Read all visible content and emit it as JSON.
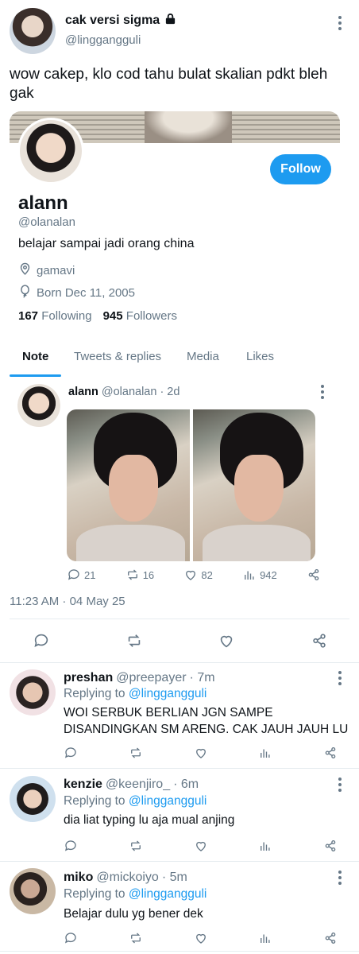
{
  "quote_tweet": {
    "display_name": "cak versi sigma",
    "handle": "@linggangguli",
    "text": "wow cakep, klo cod tahu bulat skalian pdkt bleh gak"
  },
  "profile": {
    "name": "alann",
    "handle": "@olanalan",
    "follow_label": "Follow",
    "bio": "belajar sampai jadi orang china",
    "location": "gamavi",
    "born": "Born Dec 11, 2005",
    "following_count": "167",
    "following_label": "Following",
    "followers_count": "945",
    "followers_label": "Followers",
    "tabs": [
      "Note",
      "Tweets & replies",
      "Media",
      "Likes"
    ],
    "active_tab": "Note"
  },
  "pinned_tweet": {
    "name": "alann",
    "handle": "@olanalan",
    "age": "· 2d",
    "replies": "21",
    "retweets": "16",
    "likes": "82",
    "views": "942",
    "timestamp": "11:23 AM · 04 May 25"
  },
  "replies": [
    {
      "name": "preshan",
      "handle": "@preepayer",
      "age": "· 7m",
      "replying_to_label": "Replying to",
      "replying_to": "@linggangguli",
      "text": "WOI SERBUK BERLIAN JGN SAMPE DISANDINGKAN SM ARENG. CAK JAUH JAUH LU"
    },
    {
      "name": "kenzie",
      "handle": "@keenjiro_",
      "age": "· 6m",
      "replying_to_label": "Replying to",
      "replying_to": "@linggangguli",
      "text": "dia liat typing lu aja mual anjing"
    },
    {
      "name": "miko",
      "handle": "@mickoiyo",
      "age": "· 5m",
      "replying_to_label": "Replying to",
      "replying_to": "@linggangguli",
      "text": "Belajar dulu yg bener dek"
    }
  ],
  "colors": {
    "accent": "#1d9bf0",
    "muted": "#657786",
    "divider": "#e6ecf0"
  }
}
